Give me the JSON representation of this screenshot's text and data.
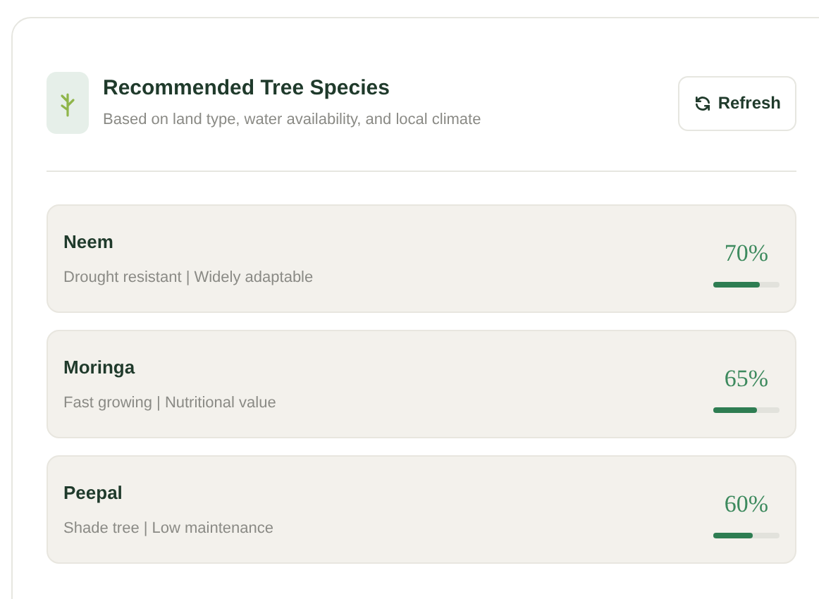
{
  "header": {
    "title": "Recommended Tree Species",
    "subtitle": "Based on land type, water availability, and local climate",
    "refresh_button": "Refresh"
  },
  "species": [
    {
      "name": "Neem",
      "traits": "Drought resistant | Widely adaptable",
      "score": "70%",
      "level": 0.7
    },
    {
      "name": "Moringa",
      "traits": "Fast growing | Nutritional value",
      "score": "65%",
      "level": 0.65
    },
    {
      "name": "Peepal",
      "traits": "Shade tree | Low maintenance",
      "score": "60%",
      "level": 0.6
    }
  ]
}
